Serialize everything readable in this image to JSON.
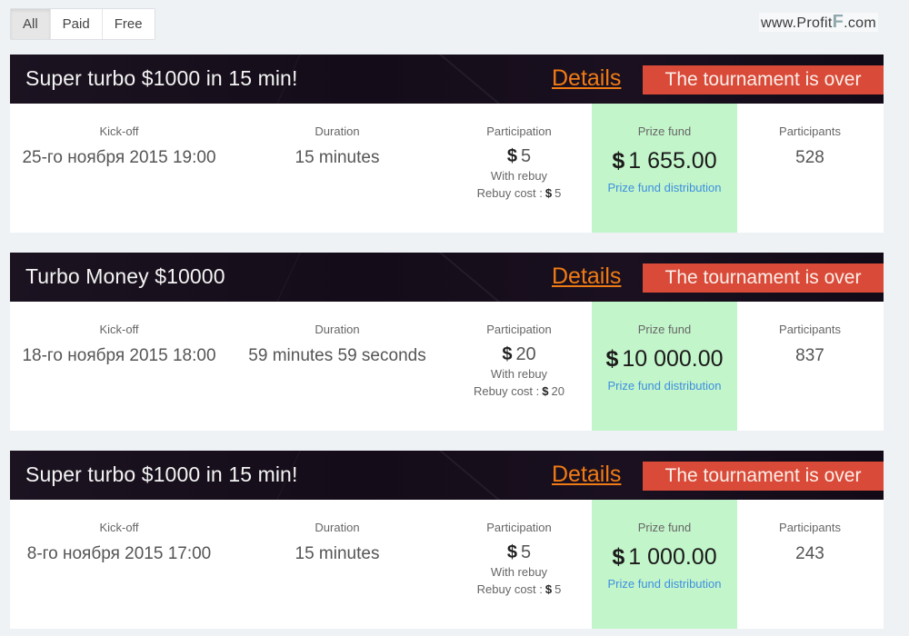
{
  "filters": {
    "tabs": [
      {
        "label": "All",
        "active": true
      },
      {
        "label": "Paid",
        "active": false
      },
      {
        "label": "Free",
        "active": false
      }
    ]
  },
  "watermark": {
    "prefix": "www.Profit",
    "highlight": "F",
    "suffix": ".com"
  },
  "labels": {
    "kickoff": "Kick-off",
    "duration": "Duration",
    "participation": "Participation",
    "prize_fund": "Prize fund",
    "participants": "Participants",
    "details": "Details",
    "prize_distribution": "Prize fund distribution",
    "with_rebuy": "With rebuy",
    "rebuy_cost": "Rebuy cost :",
    "currency": "$"
  },
  "tournaments": [
    {
      "title": "Super turbo $1000 in 15 min!",
      "status": "The tournament is over",
      "kickoff": "25-го ноября 2015 19:00",
      "duration": "15 minutes",
      "participation": "5",
      "rebuy_cost": "5",
      "prize_fund": "1 655.00",
      "participants": "528"
    },
    {
      "title": "Turbo Money $10000",
      "status": "The tournament is over",
      "kickoff": "18-го ноября 2015 18:00",
      "duration": "59 minutes 59 seconds",
      "participation": "20",
      "rebuy_cost": "20",
      "prize_fund": "10 000.00",
      "participants": "837"
    },
    {
      "title": "Super turbo $1000 in 15 min!",
      "status": "The tournament is over",
      "kickoff": "8-го ноября 2015 17:00",
      "duration": "15 minutes",
      "participation": "5",
      "rebuy_cost": "5",
      "prize_fund": "1 000.00",
      "participants": "243"
    }
  ],
  "colors": {
    "background": "#eff2f5",
    "header": "#150d19",
    "details_link": "#f07b14",
    "status_badge": "#d94a38",
    "prize_fund_bg": "#c3f5ca",
    "prize_link": "#3d8fe0"
  }
}
